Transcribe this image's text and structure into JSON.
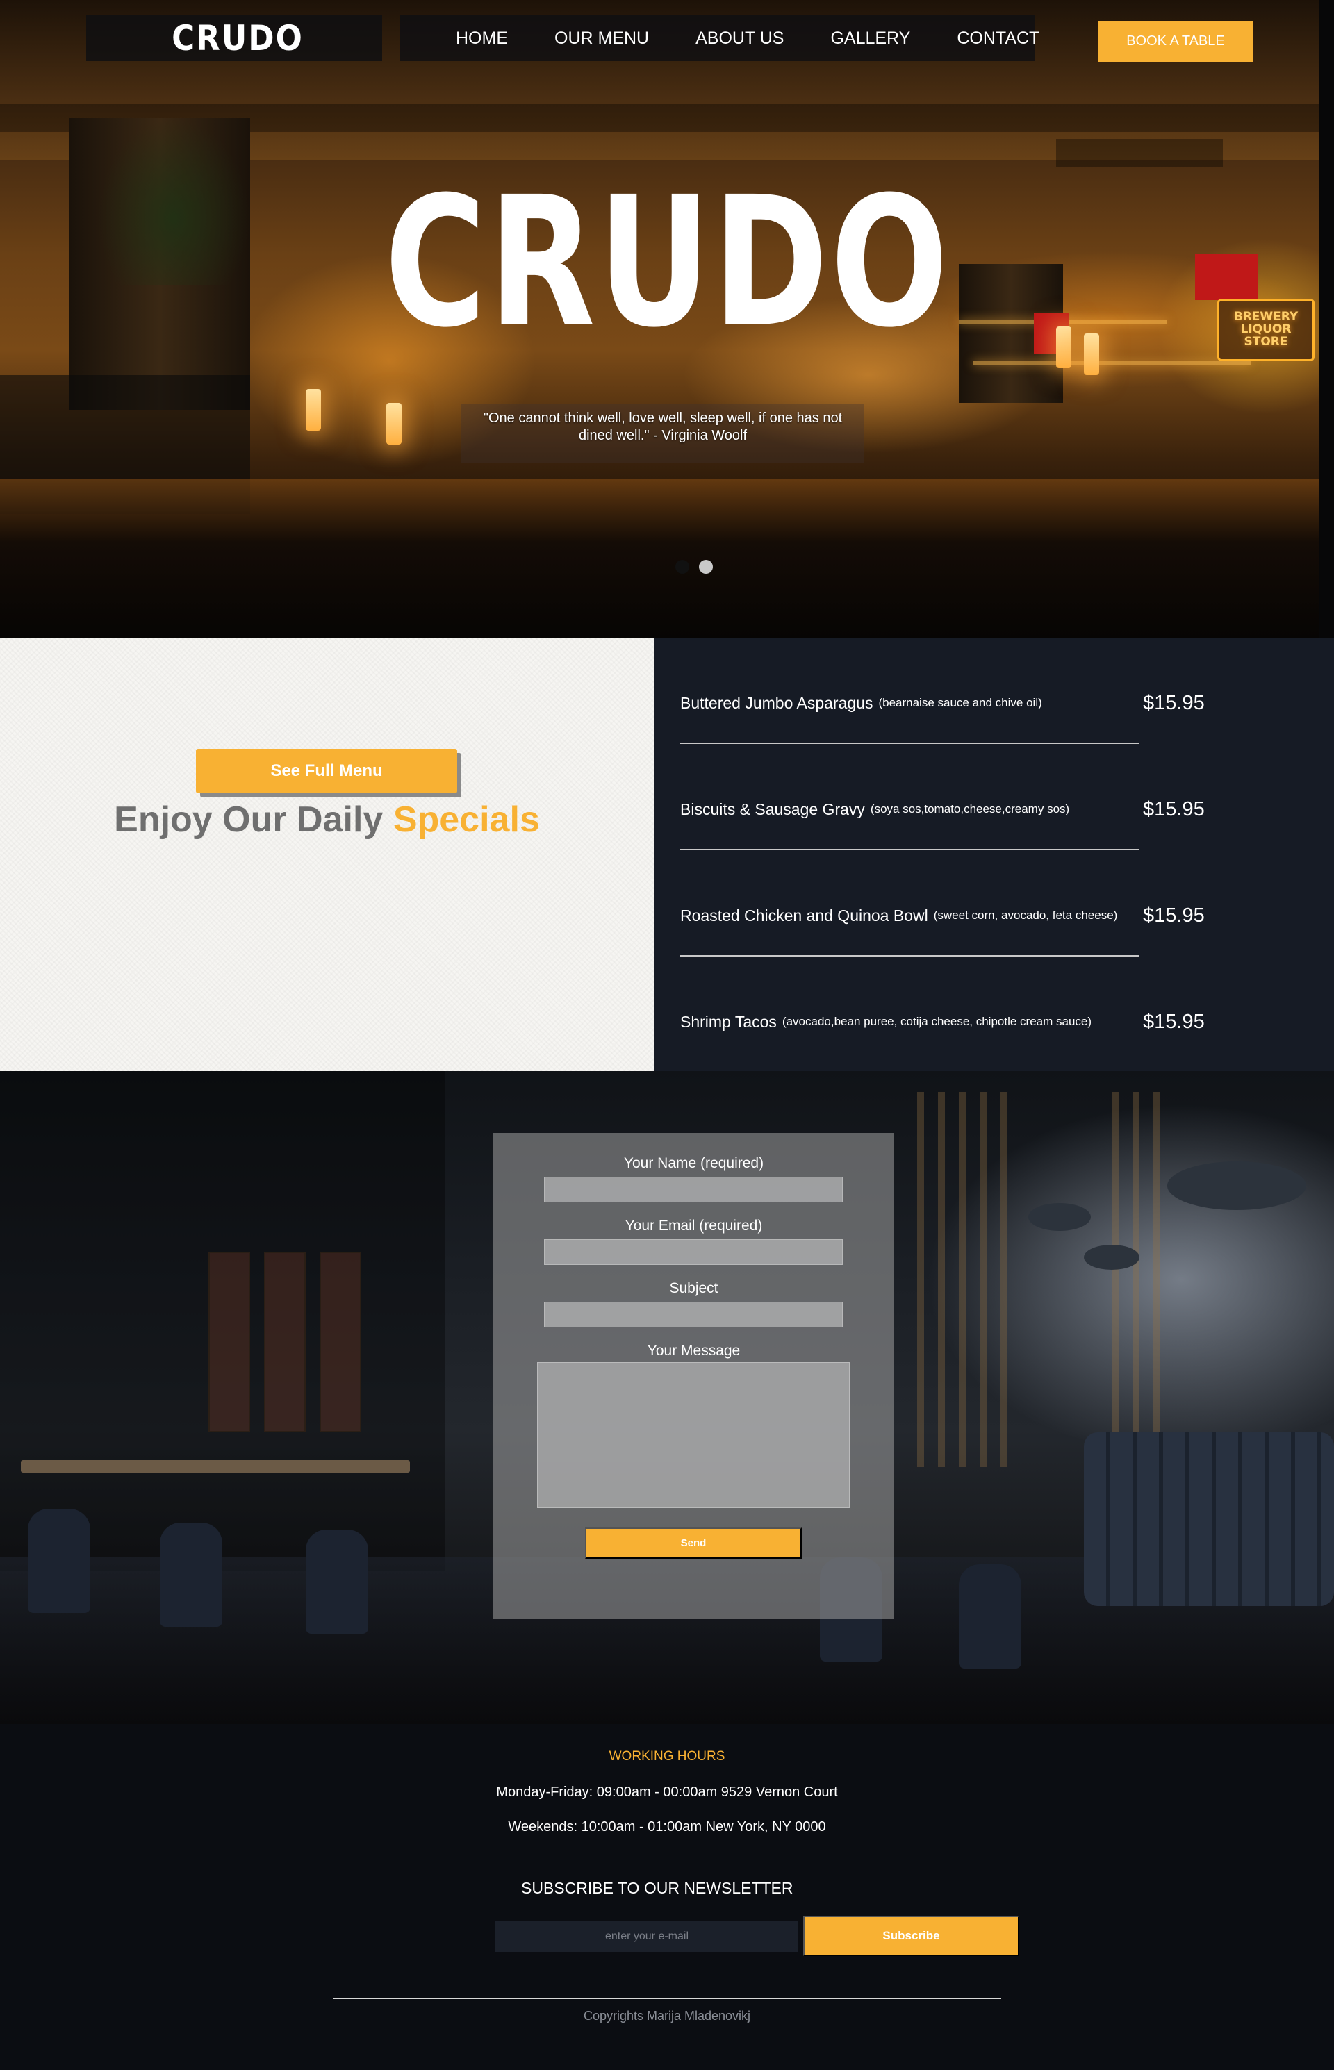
{
  "brand": {
    "logo_text": "CRUDO"
  },
  "nav": {
    "items": [
      {
        "label": "HOME"
      },
      {
        "label": "OUR MENU"
      },
      {
        "label": "ABOUT US"
      },
      {
        "label": "GALLERY"
      },
      {
        "label": "CONTACT"
      }
    ],
    "cta_label": "BOOK A TABLE"
  },
  "hero": {
    "title": "CRUDO",
    "quote_line1": "\"One cannot think well, love well, sleep well, if one has not",
    "quote_line2": "dined well.\" - Virginia Woolf",
    "background_sign": "BREWERY LIQUOR STORE",
    "slides_total": 2,
    "slide_active": 1
  },
  "specials": {
    "button_label": "See Full Menu",
    "heading_main": "Enjoy Our Daily",
    "heading_accent": "Specials",
    "items": [
      {
        "name": "Buttered Jumbo Asparagus",
        "desc": "(bearnaise sauce and chive oil)",
        "price": "$15.95"
      },
      {
        "name": "Biscuits & Sausage Gravy",
        "desc": "(soya sos,tomato,cheese,creamy sos)",
        "price": "$15.95"
      },
      {
        "name": "Roasted Chicken and Quinoa Bowl",
        "desc": "(sweet corn, avocado, feta cheese)",
        "price": "$15.95"
      },
      {
        "name": "Shrimp Tacos",
        "desc": "(avocado,bean puree, cotija cheese, chipotle cream sauce)",
        "price": "$15.95"
      }
    ]
  },
  "contact_form": {
    "name_label": "Your Name (required)",
    "email_label": "Your Email (required)",
    "subject_label": "Subject",
    "message_label": "Your Message",
    "send_label": "Send"
  },
  "footer": {
    "hours_title": "WORKING HOURS",
    "hours_weekday": "Monday-Friday: 09:00am - 00:00am 9529 Vernon Court",
    "hours_weekend": "Weekends: 10:00am - 01:00am New York, NY 0000",
    "newsletter_title": "SUBSCRIBE TO OUR NEWSLETTER",
    "email_placeholder": "enter your e-mail",
    "subscribe_label": "Subscribe",
    "copyright": "Copyrights Marija Mladenovikj"
  },
  "colors": {
    "accent": "#f8b133",
    "dark_panel": "#161b25",
    "footer_bg": "#0b0d12",
    "light_panel": "#f6f5f2"
  }
}
